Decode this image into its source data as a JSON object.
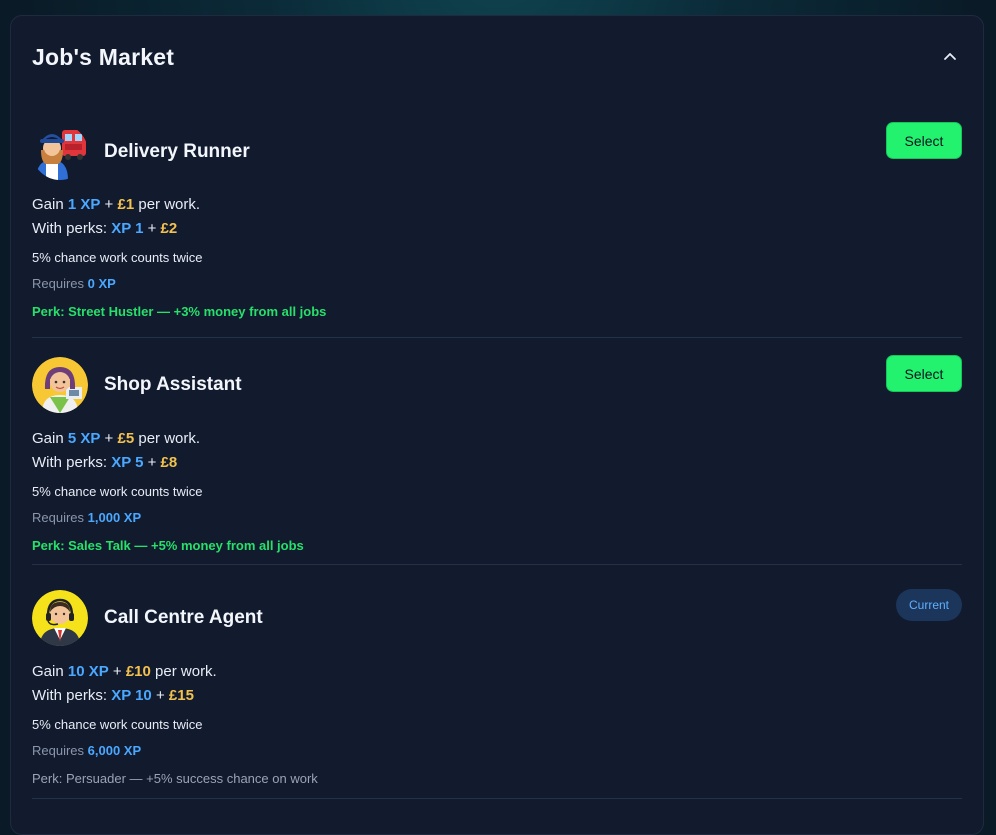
{
  "panel": {
    "title": "Job's Market"
  },
  "jobs": [
    {
      "name": "Delivery Runner",
      "gain_prefix": "Gain ",
      "gain_xp": "1 XP",
      "gain_plus": " + ",
      "gain_money": "£1",
      "gain_suffix": " per work.",
      "perks_prefix": "With perks: ",
      "perks_xp": "XP 1",
      "perks_plus": " + ",
      "perks_money": "£2",
      "chance": "5% chance work counts twice",
      "requires_label": "Requires ",
      "requires_value": "0 XP",
      "perk": "Perk: Street Hustler — +3% money from all jobs",
      "action": "Select"
    },
    {
      "name": "Shop Assistant",
      "gain_prefix": "Gain ",
      "gain_xp": "5 XP",
      "gain_plus": " + ",
      "gain_money": "£5",
      "gain_suffix": " per work.",
      "perks_prefix": "With perks: ",
      "perks_xp": "XP 5",
      "perks_plus": " + ",
      "perks_money": "£8",
      "chance": "5% chance work counts twice",
      "requires_label": "Requires ",
      "requires_value": "1,000 XP",
      "perk": "Perk: Sales Talk — +5% money from all jobs",
      "action": "Select"
    },
    {
      "name": "Call Centre Agent",
      "gain_prefix": "Gain ",
      "gain_xp": "10 XP",
      "gain_plus": " + ",
      "gain_money": "£10",
      "gain_suffix": " per work.",
      "perks_prefix": "With perks: ",
      "perks_xp": "XP 10",
      "perks_plus": " + ",
      "perks_money": "£15",
      "chance": "5% chance work counts twice",
      "requires_label": "Requires ",
      "requires_value": "6,000 XP",
      "perk": "Perk: Persuader — +5% success chance on work",
      "action": "Current"
    }
  ],
  "colors": {
    "xp": "#4aa8ff",
    "money": "#f2c14e",
    "select": "#23f26f",
    "perk_active": "#27e06a"
  }
}
